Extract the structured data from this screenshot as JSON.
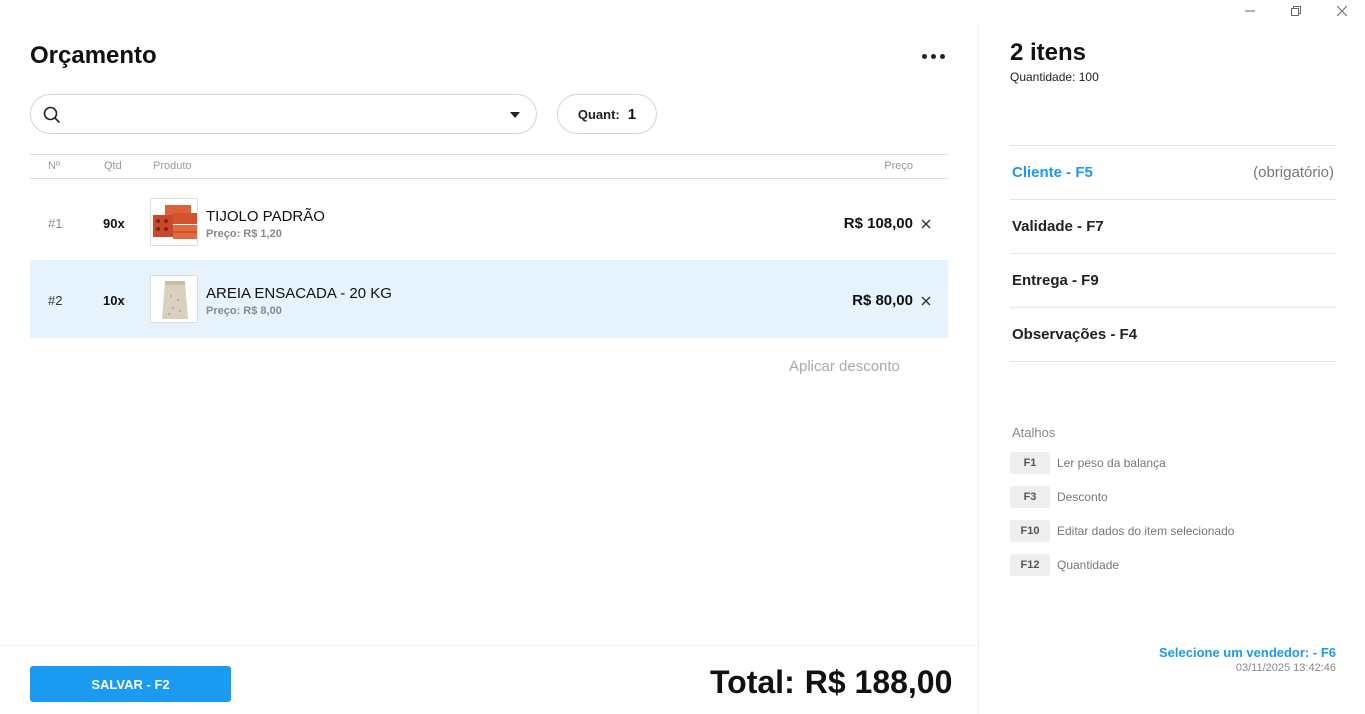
{
  "window": {
    "controls": [
      "minimize-icon",
      "restore-icon",
      "close-icon"
    ]
  },
  "header": {
    "title": "Orçamento",
    "more_icon": "more-dots-icon"
  },
  "search": {
    "placeholder": "",
    "value": ""
  },
  "quantity_box": {
    "label": "Quant:",
    "value": "1"
  },
  "table": {
    "columns": [
      "Nº",
      "Qtd",
      "Produto",
      "Preço"
    ],
    "rows": [
      {
        "num": "#1",
        "qty": "90x",
        "name": "TIJOLO PADRÃO",
        "unit_price": "Preço: R$ 1,20",
        "total": "R$ 108,00",
        "selected": false,
        "image": "brick-image"
      },
      {
        "num": "#2",
        "qty": "10x",
        "name": "AREIA ENSACADA - 20 KG",
        "unit_price": "Preço: R$ 8,00",
        "total": "R$ 80,00",
        "selected": true,
        "image": "sand-bag-image"
      }
    ]
  },
  "discount_link": "Aplicar desconto",
  "footer": {
    "save_label": "SALVAR - F2",
    "total_label": "Total:",
    "total_value": "R$ 188,00"
  },
  "sidebar": {
    "count": "2 itens",
    "quantity": "Quantidade: 100",
    "items": [
      {
        "label": "Cliente - F5",
        "note": "(obrigatório)"
      },
      {
        "label": "Validade - F7",
        "note": ""
      },
      {
        "label": "Entrega - F9",
        "note": ""
      },
      {
        "label": "Observações - F4",
        "note": ""
      }
    ],
    "shortcuts_title": "Atalhos",
    "shortcuts": [
      {
        "key": "F1",
        "label": "Ler peso da balança"
      },
      {
        "key": "F3",
        "label": "Desconto"
      },
      {
        "key": "F10",
        "label": "Editar dados do item selecionado"
      },
      {
        "key": "F12",
        "label": "Quantidade"
      }
    ],
    "seller": "Selecione um vendedor: - F6",
    "timestamp": "03/11/2025 13:42:46"
  },
  "colors": {
    "accent": "#1a9af0",
    "selected_row": "#e6f3fc"
  }
}
